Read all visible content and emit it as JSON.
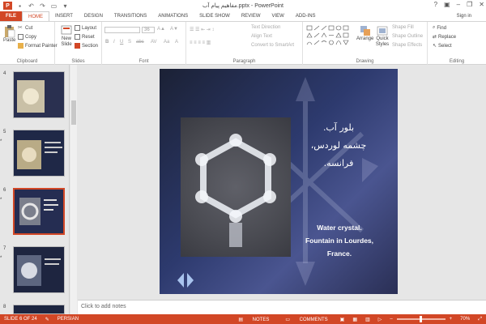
{
  "window": {
    "title": "مفاهیم پیام آب.pptx - PowerPoint",
    "app_logo": "P",
    "sign_in": "Sign in"
  },
  "tabs": [
    {
      "label": "FILE"
    },
    {
      "label": "HOME"
    },
    {
      "label": "INSERT"
    },
    {
      "label": "DESIGN"
    },
    {
      "label": "TRANSITIONS"
    },
    {
      "label": "ANIMATIONS"
    },
    {
      "label": "SLIDE SHOW"
    },
    {
      "label": "REVIEW"
    },
    {
      "label": "VIEW"
    },
    {
      "label": "ADD-INS"
    }
  ],
  "ribbon": {
    "clipboard": {
      "label": "Clipboard",
      "paste": "Paste",
      "cut": "Cut",
      "copy": "Copy",
      "format_painter": "Format Painter"
    },
    "slides": {
      "label": "Slides",
      "new_slide": "New Slide",
      "layout": "Layout",
      "reset": "Reset",
      "section": "Section"
    },
    "font": {
      "label": "Font",
      "size": "36"
    },
    "paragraph": {
      "label": "Paragraph",
      "text_direction": "Text Direction",
      "align_text": "Align Text",
      "convert_smartart": "Convert to SmartArt"
    },
    "drawing": {
      "label": "Drawing",
      "arrange": "Arrange",
      "quick_styles": "Quick Styles",
      "shape_fill": "Shape Fill",
      "shape_outline": "Shape Outline",
      "shape_effects": "Shape Effects"
    },
    "editing": {
      "label": "Editing",
      "find": "Find",
      "replace": "Replace",
      "select": "Select"
    }
  },
  "thumbnails": [
    {
      "number": "4",
      "star": "",
      "selected": false
    },
    {
      "number": "5",
      "star": "*",
      "selected": false
    },
    {
      "number": "6",
      "star": "*",
      "selected": true
    },
    {
      "number": "7",
      "star": "*",
      "selected": false
    },
    {
      "number": "8",
      "star": "",
      "selected": false
    }
  ],
  "slide": {
    "persian_lines": [
      "بلور آب.",
      "چشمه لوردس،",
      "فرانسه."
    ],
    "english_lines": [
      "Water crystal.",
      "Fountain in Lourdes,",
      "France."
    ]
  },
  "notes": {
    "placeholder": "Click to add notes"
  },
  "status": {
    "slide_count": "SLIDE 6 OF 24",
    "language": "PERSIAN",
    "notes": "NOTES",
    "comments": "COMMENTS",
    "zoom": "70%"
  },
  "colors": {
    "accent": "#d24726"
  }
}
